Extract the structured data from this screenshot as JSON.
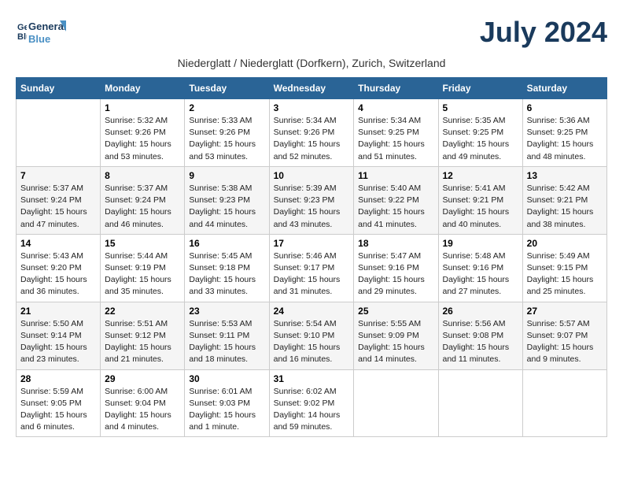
{
  "app": {
    "logo_line1": "General",
    "logo_line2": "Blue"
  },
  "header": {
    "month_year": "July 2024",
    "location": "Niederglatt / Niederglatt (Dorfkern), Zurich, Switzerland"
  },
  "weekdays": [
    "Sunday",
    "Monday",
    "Tuesday",
    "Wednesday",
    "Thursday",
    "Friday",
    "Saturday"
  ],
  "weeks": [
    [
      {
        "day": "",
        "info": ""
      },
      {
        "day": "1",
        "info": "Sunrise: 5:32 AM\nSunset: 9:26 PM\nDaylight: 15 hours\nand 53 minutes."
      },
      {
        "day": "2",
        "info": "Sunrise: 5:33 AM\nSunset: 9:26 PM\nDaylight: 15 hours\nand 53 minutes."
      },
      {
        "day": "3",
        "info": "Sunrise: 5:34 AM\nSunset: 9:26 PM\nDaylight: 15 hours\nand 52 minutes."
      },
      {
        "day": "4",
        "info": "Sunrise: 5:34 AM\nSunset: 9:25 PM\nDaylight: 15 hours\nand 51 minutes."
      },
      {
        "day": "5",
        "info": "Sunrise: 5:35 AM\nSunset: 9:25 PM\nDaylight: 15 hours\nand 49 minutes."
      },
      {
        "day": "6",
        "info": "Sunrise: 5:36 AM\nSunset: 9:25 PM\nDaylight: 15 hours\nand 48 minutes."
      }
    ],
    [
      {
        "day": "7",
        "info": "Sunrise: 5:37 AM\nSunset: 9:24 PM\nDaylight: 15 hours\nand 47 minutes."
      },
      {
        "day": "8",
        "info": "Sunrise: 5:37 AM\nSunset: 9:24 PM\nDaylight: 15 hours\nand 46 minutes."
      },
      {
        "day": "9",
        "info": "Sunrise: 5:38 AM\nSunset: 9:23 PM\nDaylight: 15 hours\nand 44 minutes."
      },
      {
        "day": "10",
        "info": "Sunrise: 5:39 AM\nSunset: 9:23 PM\nDaylight: 15 hours\nand 43 minutes."
      },
      {
        "day": "11",
        "info": "Sunrise: 5:40 AM\nSunset: 9:22 PM\nDaylight: 15 hours\nand 41 minutes."
      },
      {
        "day": "12",
        "info": "Sunrise: 5:41 AM\nSunset: 9:21 PM\nDaylight: 15 hours\nand 40 minutes."
      },
      {
        "day": "13",
        "info": "Sunrise: 5:42 AM\nSunset: 9:21 PM\nDaylight: 15 hours\nand 38 minutes."
      }
    ],
    [
      {
        "day": "14",
        "info": "Sunrise: 5:43 AM\nSunset: 9:20 PM\nDaylight: 15 hours\nand 36 minutes."
      },
      {
        "day": "15",
        "info": "Sunrise: 5:44 AM\nSunset: 9:19 PM\nDaylight: 15 hours\nand 35 minutes."
      },
      {
        "day": "16",
        "info": "Sunrise: 5:45 AM\nSunset: 9:18 PM\nDaylight: 15 hours\nand 33 minutes."
      },
      {
        "day": "17",
        "info": "Sunrise: 5:46 AM\nSunset: 9:17 PM\nDaylight: 15 hours\nand 31 minutes."
      },
      {
        "day": "18",
        "info": "Sunrise: 5:47 AM\nSunset: 9:16 PM\nDaylight: 15 hours\nand 29 minutes."
      },
      {
        "day": "19",
        "info": "Sunrise: 5:48 AM\nSunset: 9:16 PM\nDaylight: 15 hours\nand 27 minutes."
      },
      {
        "day": "20",
        "info": "Sunrise: 5:49 AM\nSunset: 9:15 PM\nDaylight: 15 hours\nand 25 minutes."
      }
    ],
    [
      {
        "day": "21",
        "info": "Sunrise: 5:50 AM\nSunset: 9:14 PM\nDaylight: 15 hours\nand 23 minutes."
      },
      {
        "day": "22",
        "info": "Sunrise: 5:51 AM\nSunset: 9:12 PM\nDaylight: 15 hours\nand 21 minutes."
      },
      {
        "day": "23",
        "info": "Sunrise: 5:53 AM\nSunset: 9:11 PM\nDaylight: 15 hours\nand 18 minutes."
      },
      {
        "day": "24",
        "info": "Sunrise: 5:54 AM\nSunset: 9:10 PM\nDaylight: 15 hours\nand 16 minutes."
      },
      {
        "day": "25",
        "info": "Sunrise: 5:55 AM\nSunset: 9:09 PM\nDaylight: 15 hours\nand 14 minutes."
      },
      {
        "day": "26",
        "info": "Sunrise: 5:56 AM\nSunset: 9:08 PM\nDaylight: 15 hours\nand 11 minutes."
      },
      {
        "day": "27",
        "info": "Sunrise: 5:57 AM\nSunset: 9:07 PM\nDaylight: 15 hours\nand 9 minutes."
      }
    ],
    [
      {
        "day": "28",
        "info": "Sunrise: 5:59 AM\nSunset: 9:05 PM\nDaylight: 15 hours\nand 6 minutes."
      },
      {
        "day": "29",
        "info": "Sunrise: 6:00 AM\nSunset: 9:04 PM\nDaylight: 15 hours\nand 4 minutes."
      },
      {
        "day": "30",
        "info": "Sunrise: 6:01 AM\nSunset: 9:03 PM\nDaylight: 15 hours\nand 1 minute."
      },
      {
        "day": "31",
        "info": "Sunrise: 6:02 AM\nSunset: 9:02 PM\nDaylight: 14 hours\nand 59 minutes."
      },
      {
        "day": "",
        "info": ""
      },
      {
        "day": "",
        "info": ""
      },
      {
        "day": "",
        "info": ""
      }
    ]
  ]
}
